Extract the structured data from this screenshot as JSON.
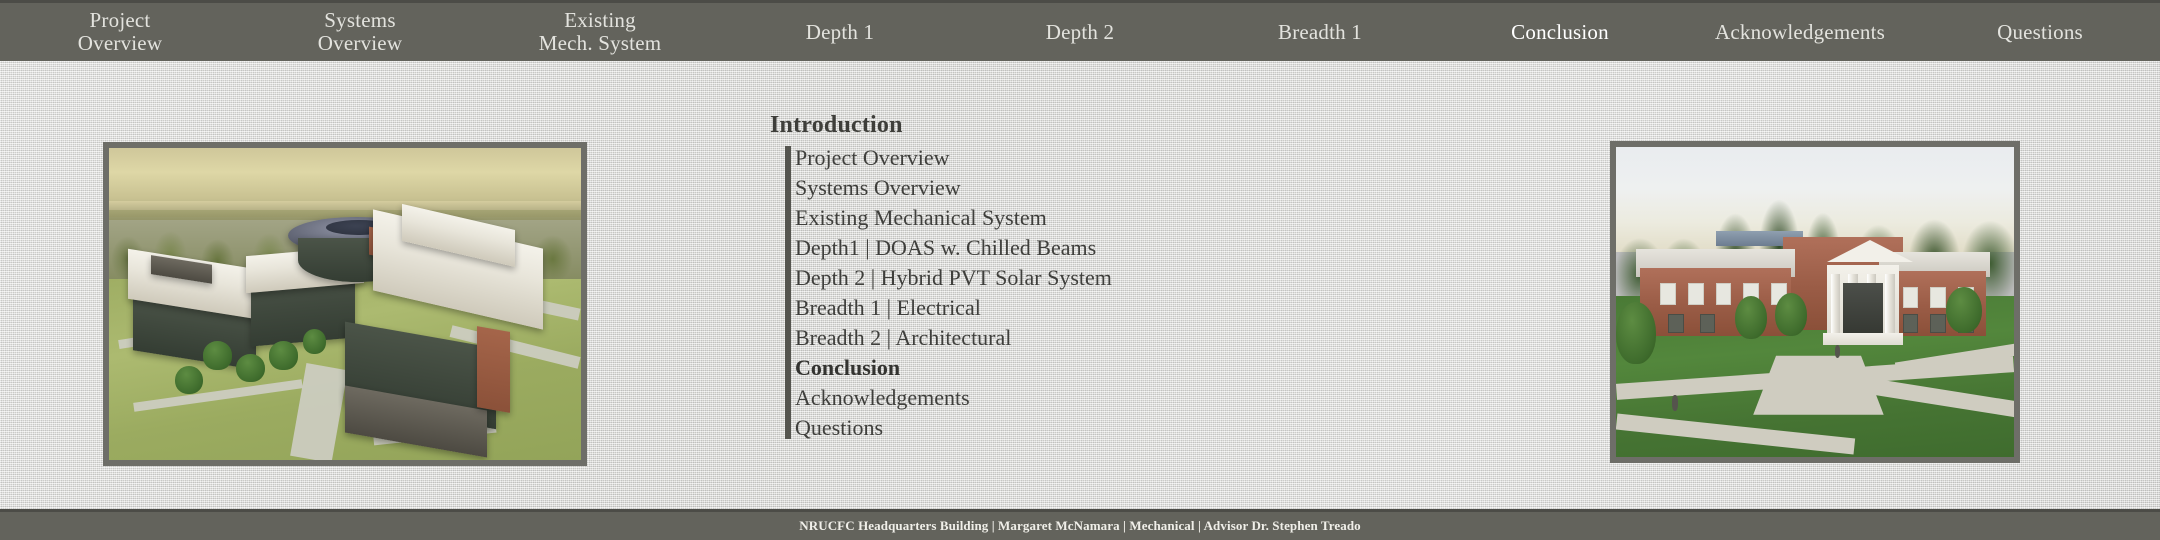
{
  "navigation": {
    "items": [
      {
        "line1": "Project",
        "line2": "Overview",
        "active": false
      },
      {
        "line1": "Systems",
        "line2": "Overview",
        "active": false
      },
      {
        "line1": "Existing",
        "line2": "Mech. System",
        "active": false
      },
      {
        "line1": "Depth 1",
        "line2": "",
        "active": false
      },
      {
        "line1": "Depth 2",
        "line2": "",
        "active": false
      },
      {
        "line1": "Breadth 1",
        "line2": "",
        "active": false
      },
      {
        "line1": "Conclusion",
        "line2": "",
        "active": true
      },
      {
        "line1": "Acknowledgements",
        "line2": "",
        "active": false
      },
      {
        "line1": "Questions",
        "line2": "",
        "active": false
      }
    ]
  },
  "content": {
    "title": "Introduction",
    "agenda": [
      {
        "label": "Project Overview",
        "current": false
      },
      {
        "label": "Systems Overview",
        "current": false
      },
      {
        "label": "Existing Mechanical System",
        "current": false
      },
      {
        "label": "Depth1 | DOAS w. Chilled Beams",
        "current": false
      },
      {
        "label": "Depth 2 | Hybrid PVT Solar System",
        "current": false
      },
      {
        "label": "Breadth 1 | Electrical",
        "current": false
      },
      {
        "label": "Breadth 2 | Architectural",
        "current": false
      },
      {
        "label": "Conclusion",
        "current": true
      },
      {
        "label": "Acknowledgements",
        "current": false
      },
      {
        "label": "Questions",
        "current": false
      }
    ]
  },
  "images": {
    "left": {
      "name": "aerial-building-rendering"
    },
    "right": {
      "name": "brick-headquarters-rendering"
    }
  },
  "footer": {
    "text": "NRUCFC Headquarters Building | Margaret McNamara | Mechanical | Advisor Dr. Stephen Treado"
  },
  "colors": {
    "bar": "#63635c",
    "bar_border": "#4c4c47",
    "background": "#d6d6d4",
    "text_dark": "#3f3f3c",
    "text_light": "#e3e3de",
    "accent_bar": "#55554f",
    "frame": "#6e6e68"
  }
}
